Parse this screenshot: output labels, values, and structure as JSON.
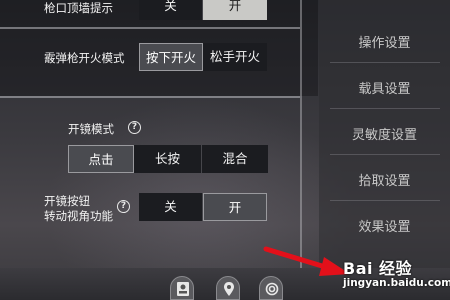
{
  "settings": {
    "muzzle_wall_hint": {
      "label": "枪口顶墙提示",
      "options": [
        "关",
        "开"
      ],
      "selected": "开"
    },
    "shotgun_fire_mode": {
      "label": "霰弹枪开火模式",
      "options": [
        "按下开火",
        "松手开火"
      ],
      "selected": "按下开火"
    },
    "scope_mode": {
      "label": "开镜模式",
      "options": [
        "点击",
        "长按",
        "混合"
      ],
      "selected": "点击"
    },
    "scope_button_view": {
      "label_line1": "开镜按钮",
      "label_line2": "转动视角功能",
      "options": [
        "关",
        "开"
      ],
      "selected": "开"
    }
  },
  "sidebar": {
    "items": [
      {
        "label": "操作设置"
      },
      {
        "label": "载具设置"
      },
      {
        "label": "灵敏度设置"
      },
      {
        "label": "拾取设置"
      },
      {
        "label": "效果设置"
      }
    ]
  },
  "bottom_icons": [
    "person-card-icon",
    "location-pin-icon",
    "spiral-icon"
  ],
  "watermark": {
    "brand": "Bai 经验",
    "url": "jingyan.baidu.com"
  },
  "colors": {
    "active_option": "#c9c9c6",
    "inactive_option": "#1b1c20",
    "arrow": "#e3101a"
  }
}
